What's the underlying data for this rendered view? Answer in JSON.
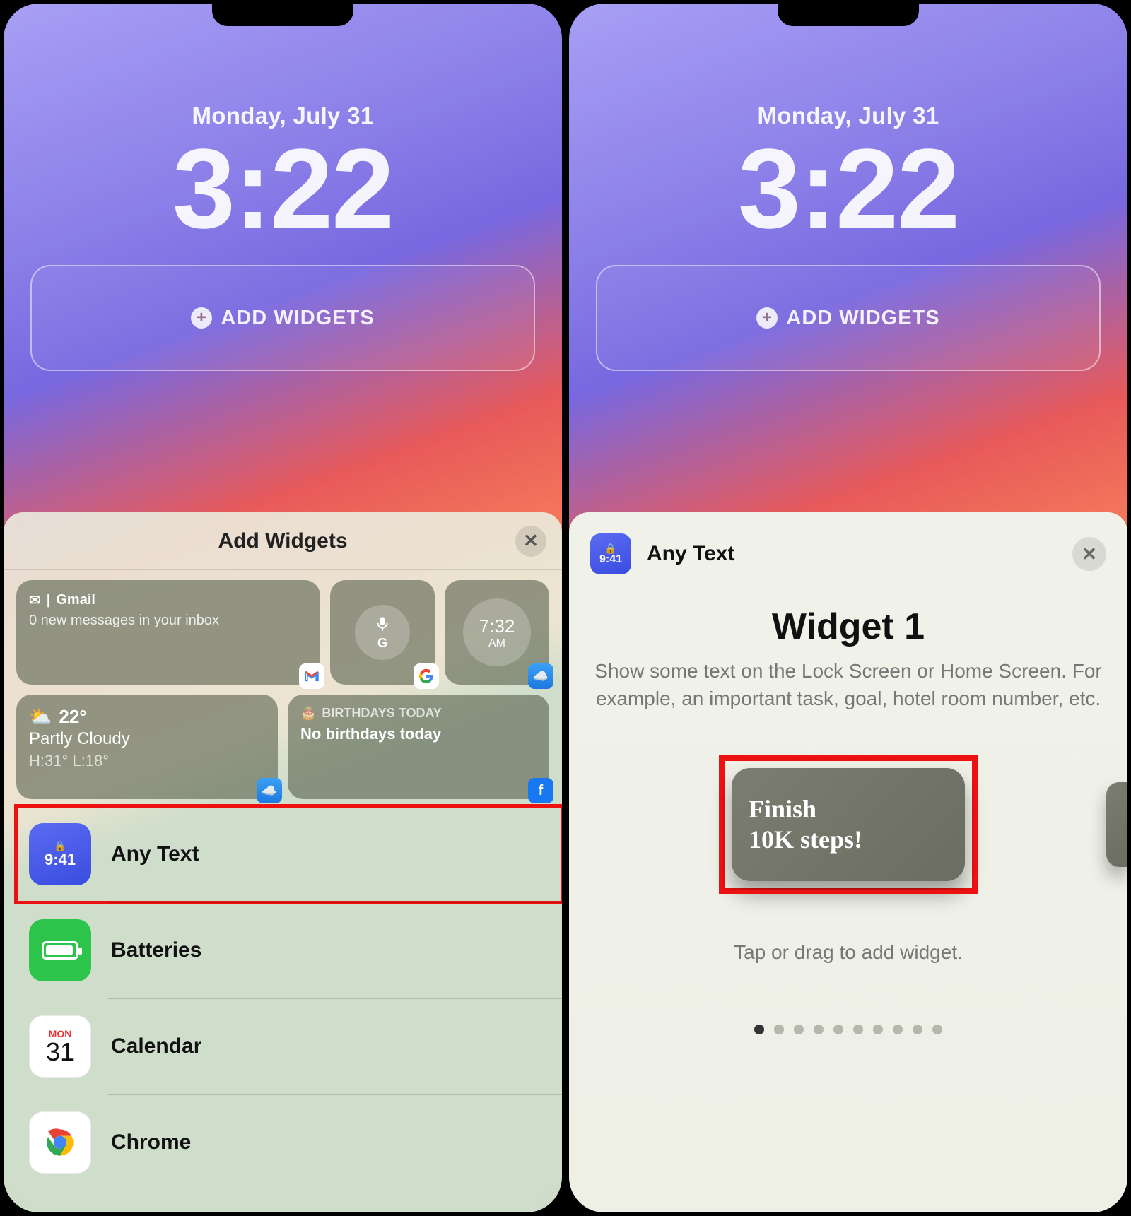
{
  "date": "Monday, July 31",
  "time": "3:22",
  "add_widgets_label": "ADD WIDGETS",
  "left_sheet": {
    "title": "Add Widgets",
    "gmail": {
      "title": "Gmail",
      "sub": "0 new messages in your inbox"
    },
    "clock": {
      "time": "7:32",
      "ampm": "AM"
    },
    "weather": {
      "temp": "22°",
      "cond": "Partly Cloudy",
      "hl": "H:31° L:18°"
    },
    "birthdays": {
      "label": "BIRTHDAYS TODAY",
      "text": "No birthdays today"
    },
    "apps": {
      "anytext": {
        "name": "Any Text",
        "icon_time": "9:41"
      },
      "batteries": "Batteries",
      "calendar": {
        "name": "Calendar",
        "dow": "MON",
        "dnum": "31"
      },
      "chrome": "Chrome"
    }
  },
  "right_sheet": {
    "app_title": "Any Text",
    "icon_time": "9:41",
    "widget_name": "Widget 1",
    "desc": "Show some text on the Lock Screen or Home Screen. For example, an important task, goal, hotel room number, etc.",
    "preview_line1": "Finish",
    "preview_line2": "10K steps!",
    "hint": "Tap or drag to add widget.",
    "dots_total": 10,
    "dots_active_index": 0
  }
}
